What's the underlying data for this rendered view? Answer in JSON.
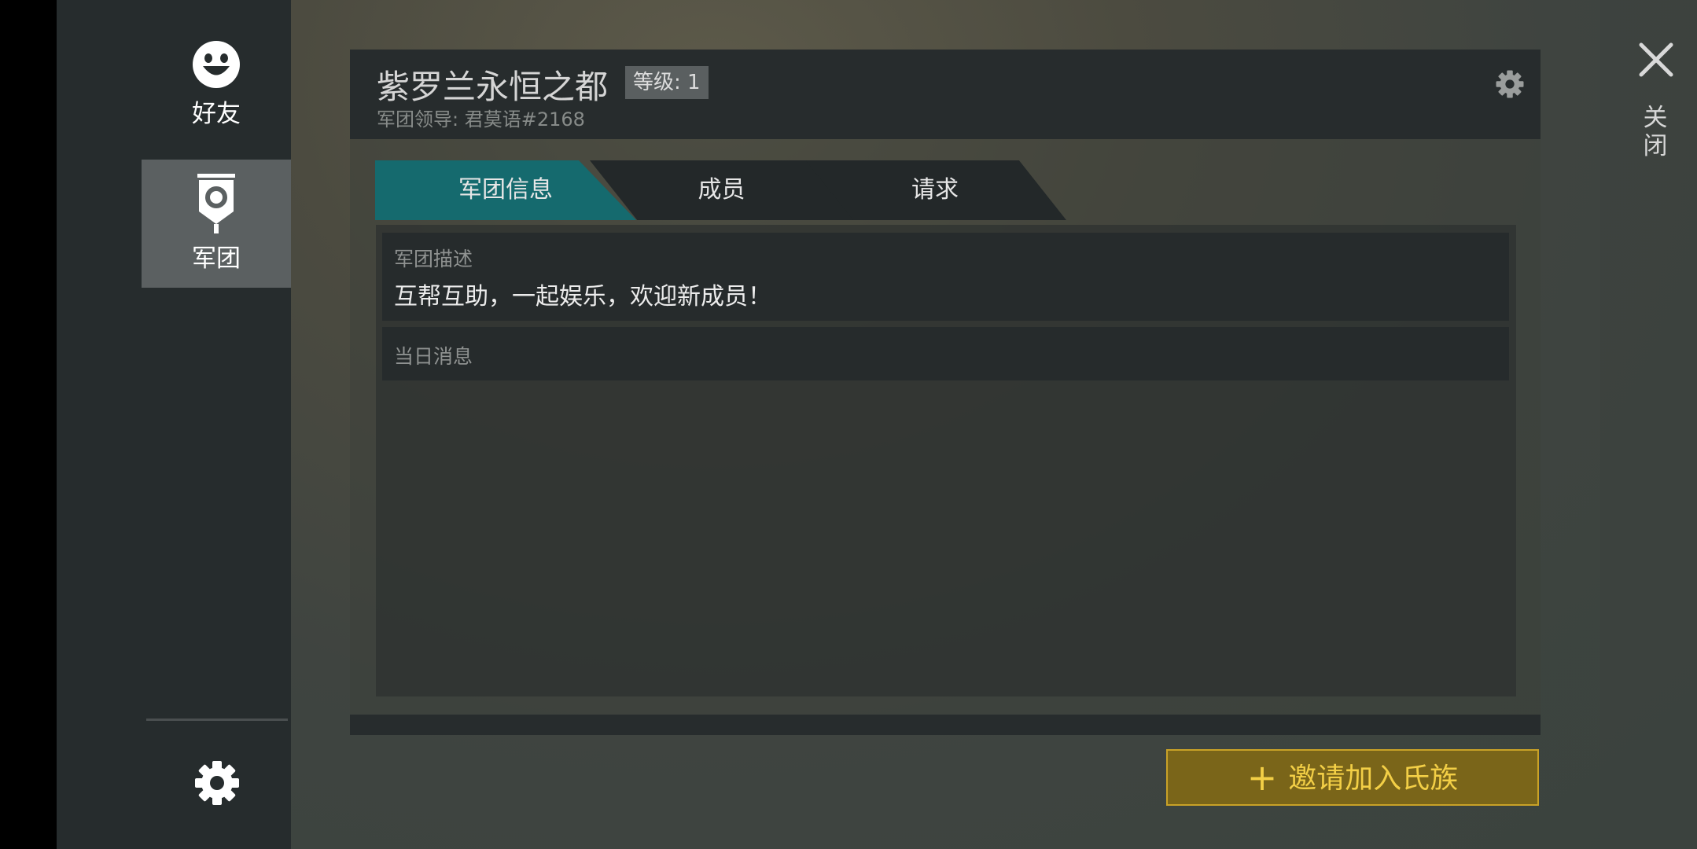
{
  "sidebar": {
    "friends_label": "好友",
    "legion_label": "军团"
  },
  "clan": {
    "name": "紫罗兰永恒之都",
    "level": "等级: 1",
    "leader": "军团领导: 君莫语#2168"
  },
  "tabs": {
    "info": "军团信息",
    "members": "成员",
    "requests": "请求"
  },
  "info": {
    "description_label": "军团描述",
    "description_text": "互帮互助，一起娱乐，欢迎新成员！",
    "motd_label": "当日消息"
  },
  "actions": {
    "invite_label": "邀请加入氏族",
    "close_label": "关闭"
  },
  "colors": {
    "tab_active": "#156a6e",
    "invite_text": "#f3cf46",
    "invite_border": "#c9a227"
  }
}
